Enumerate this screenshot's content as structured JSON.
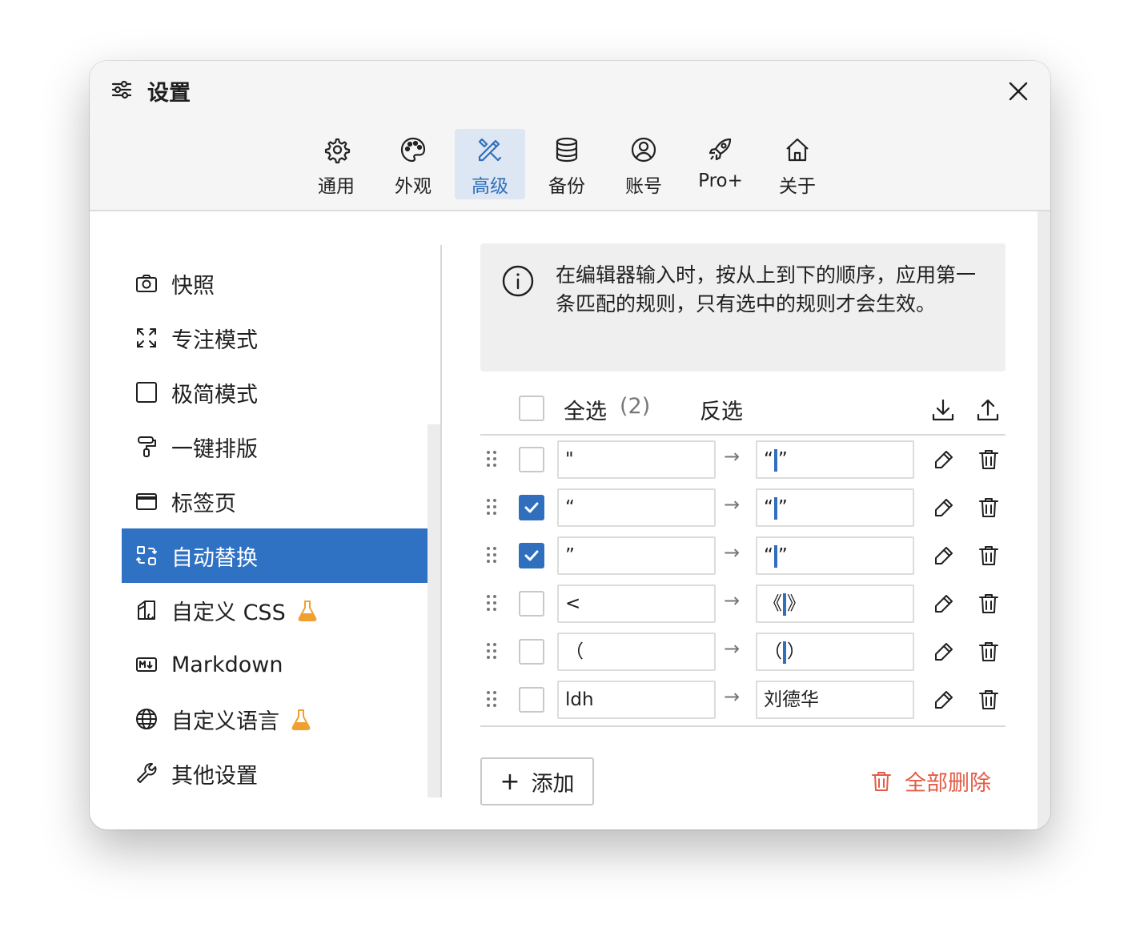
{
  "window": {
    "title": "设置"
  },
  "tabs": [
    {
      "label": "通用",
      "icon": "gear-icon"
    },
    {
      "label": "外观",
      "icon": "palette-icon"
    },
    {
      "label": "高级",
      "icon": "tools-icon",
      "active": true
    },
    {
      "label": "备份",
      "icon": "database-icon"
    },
    {
      "label": "账号",
      "icon": "user-circle-icon"
    },
    {
      "label": "Pro+",
      "icon": "rocket-icon"
    },
    {
      "label": "关于",
      "icon": "home-icon"
    }
  ],
  "sidebar": {
    "items": [
      {
        "label": "快照",
        "icon": "camera-icon"
      },
      {
        "label": "专注模式",
        "icon": "expand-icon"
      },
      {
        "label": "极简模式",
        "icon": "square-icon"
      },
      {
        "label": "一键排版",
        "icon": "paint-roller-icon"
      },
      {
        "label": "标签页",
        "icon": "folder-tab-icon"
      },
      {
        "label": "自动替换",
        "icon": "replace-icon",
        "active": true
      },
      {
        "label": "自定义 CSS",
        "icon": "css-icon",
        "badge": "flask-icon"
      },
      {
        "label": "Markdown",
        "icon": "markdown-icon"
      },
      {
        "label": "自定义语言",
        "icon": "globe-icon",
        "badge": "flask-icon"
      },
      {
        "label": "其他设置",
        "icon": "wrench-icon"
      }
    ]
  },
  "info": {
    "text": "在编辑器输入时，按从上到下的顺序，应用第一条匹配的规则，只有选中的规则才会生效。"
  },
  "list": {
    "select_all_label": "全选",
    "selected_count": "(2)",
    "invert_label": "反选",
    "arrow": "→",
    "rules": [
      {
        "from": "\"",
        "to_before": "“",
        "to_after": "”",
        "checked": false
      },
      {
        "from": "“",
        "to_before": "“",
        "to_after": "”",
        "checked": true
      },
      {
        "from": "”",
        "to_before": "“",
        "to_after": "”",
        "checked": true
      },
      {
        "from": "<",
        "to_before": "《",
        "to_after": "》",
        "checked": false
      },
      {
        "from": "（",
        "to_before": "（",
        "to_after": "）",
        "checked": false
      },
      {
        "from": "ldh",
        "to_before": "刘德华",
        "to_after": "",
        "checked": false
      }
    ]
  },
  "actions": {
    "add_label": "添加",
    "add_symbol": "+",
    "delete_all_label": "全部删除"
  },
  "colors": {
    "accent": "#2f72c4",
    "danger": "#e45c47",
    "flask": "#f0a030"
  }
}
